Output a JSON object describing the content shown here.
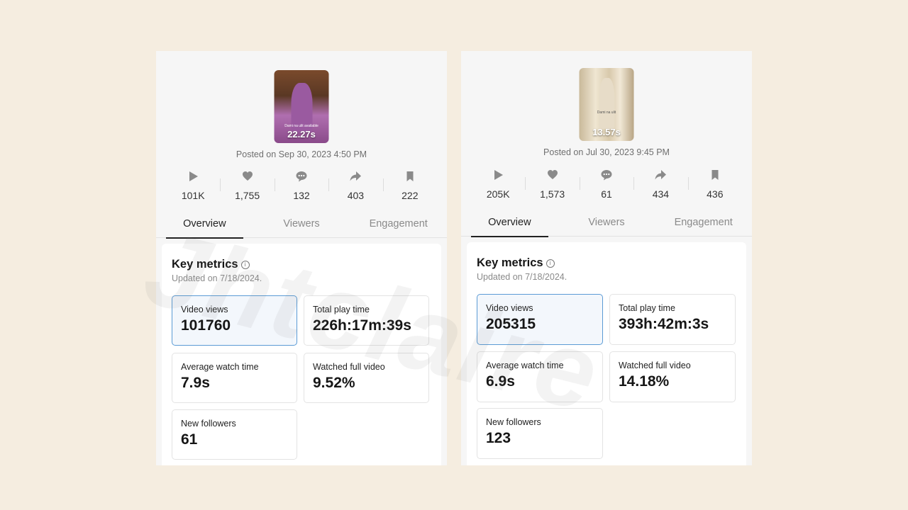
{
  "watermark_text": "Jhtclaire",
  "colors": {
    "background": "#f5ede0",
    "panel": "#f6f6f6",
    "selected_border": "#5b9bd5"
  },
  "icons": [
    "play-icon",
    "heart-icon",
    "comment-icon",
    "share-icon",
    "bookmark-icon",
    "info-icon"
  ],
  "left": {
    "thumbnail": {
      "duration": "22.27s",
      "caption": "Dami na ulit available"
    },
    "posted": "Posted on Sep 30, 2023 4:50 PM",
    "stats": {
      "views": "101K",
      "likes": "1,755",
      "comments": "132",
      "shares": "403",
      "saves": "222"
    },
    "tabs": [
      "Overview",
      "Viewers",
      "Engagement"
    ],
    "key_metrics": {
      "title": "Key metrics",
      "updated": "Updated on 7/18/2024.",
      "video_views": {
        "label": "Video views",
        "value": "101760"
      },
      "total_play_time": {
        "label": "Total play time",
        "value": "226h:17m:39s"
      },
      "avg_watch_time": {
        "label": "Average watch time",
        "value": "7.9s"
      },
      "watched_full": {
        "label": "Watched full video",
        "value": "9.52%"
      },
      "new_followers": {
        "label": "New followers",
        "value": "61"
      }
    }
  },
  "right": {
    "thumbnail": {
      "duration": "13.57s",
      "caption": "Dami na ulit"
    },
    "posted": "Posted on Jul 30, 2023 9:45 PM",
    "stats": {
      "views": "205K",
      "likes": "1,573",
      "comments": "61",
      "shares": "434",
      "saves": "436"
    },
    "tabs": [
      "Overview",
      "Viewers",
      "Engagement"
    ],
    "key_metrics": {
      "title": "Key metrics",
      "updated": "Updated on 7/18/2024.",
      "video_views": {
        "label": "Video views",
        "value": "205315"
      },
      "total_play_time": {
        "label": "Total play time",
        "value": "393h:42m:3s"
      },
      "avg_watch_time": {
        "label": "Average watch time",
        "value": "6.9s"
      },
      "watched_full": {
        "label": "Watched full video",
        "value": "14.18%"
      },
      "new_followers": {
        "label": "New followers",
        "value": "123"
      }
    }
  }
}
